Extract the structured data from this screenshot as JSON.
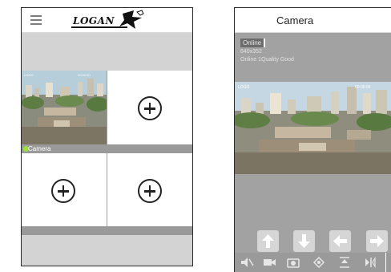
{
  "left_screen": {
    "logo_text": "LOGAN",
    "channels": [
      {
        "label": "Camera",
        "status_color": "#9be238"
      },
      {
        "label": ""
      },
      {
        "label": ""
      },
      {
        "label": ""
      }
    ],
    "add_icon": "plus-circle-icon"
  },
  "right_screen": {
    "title": "Camera",
    "status": "Online",
    "resolution": "640x352",
    "quality": "Online 1Quality Good",
    "ptz_icons": [
      "arrow-up-icon",
      "arrow-down-icon",
      "arrow-left-icon",
      "arrow-right-icon"
    ],
    "toolbar_icons": [
      "mute-icon",
      "record-icon",
      "snapshot-icon",
      "preset-icon",
      "zoom-icon",
      "mirror-icon"
    ]
  },
  "colors": {
    "grey_band": "#d3d3d3",
    "dark_band": "#9a9a9a",
    "online_dot": "#9be238"
  }
}
